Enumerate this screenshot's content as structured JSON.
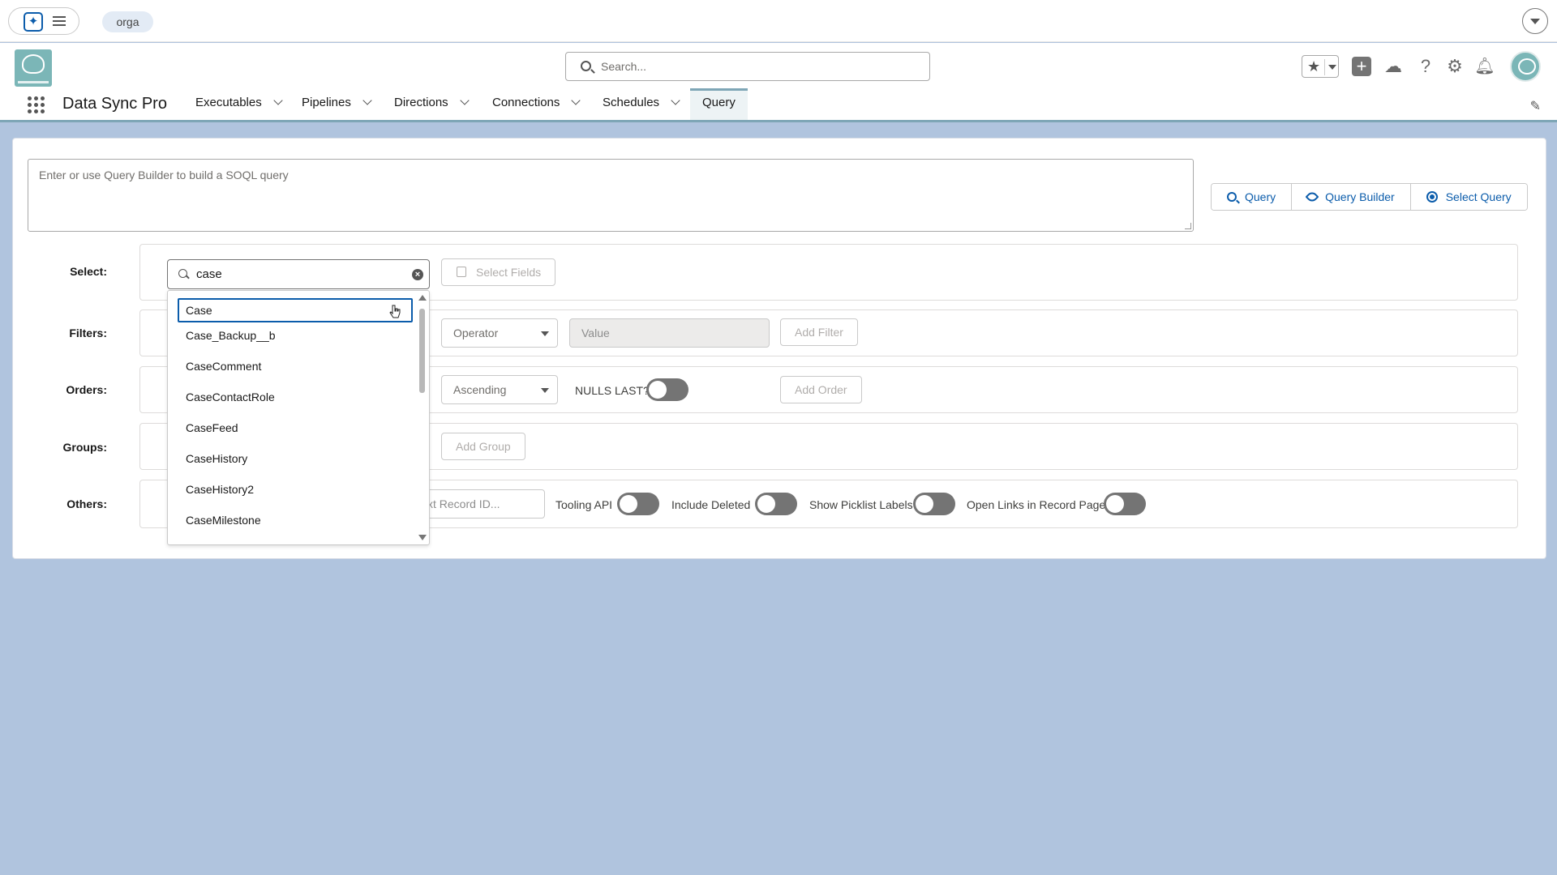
{
  "top_strip": {
    "org_chip": "orga"
  },
  "header": {
    "search_placeholder": "Search...",
    "icons": [
      "star-icon",
      "add-icon",
      "cloud-icon",
      "help-icon",
      "gear-icon",
      "bell-icon"
    ]
  },
  "nav": {
    "app_name": "Data Sync Pro",
    "items": [
      {
        "label": "Executables",
        "has_menu": true
      },
      {
        "label": "Pipelines",
        "has_menu": true
      },
      {
        "label": "Directions",
        "has_menu": true
      },
      {
        "label": "Connections",
        "has_menu": true
      },
      {
        "label": "Schedules",
        "has_menu": true
      },
      {
        "label": "Query",
        "has_menu": false,
        "active": true
      }
    ]
  },
  "query": {
    "soql_placeholder": "Enter or use Query Builder to build a SOQL query",
    "buttons": {
      "query": "Query",
      "query_builder": "Query Builder",
      "select_query": "Select Query"
    }
  },
  "builder": {
    "labels": {
      "select": "Select:",
      "filters": "Filters:",
      "orders": "Orders:",
      "groups": "Groups:",
      "others": "Others:"
    },
    "object_search_value": "case",
    "select_fields": "Select Fields",
    "operator_placeholder": "Operator",
    "value_placeholder": "Value",
    "add_filter": "Add Filter",
    "order_direction": "Ascending",
    "nulls_last": "NULLS LAST?",
    "add_order": "Add Order",
    "add_group": "Add Group",
    "record_id_placeholder": "xt Record ID...",
    "tooling_api": "Tooling API",
    "include_deleted": "Include Deleted",
    "show_picklist_labels": "Show Picklist Labels",
    "open_links": "Open Links in Record Page"
  },
  "dropdown": {
    "options": [
      "Case",
      "Case_Backup__b",
      "CaseComment",
      "CaseContactRole",
      "CaseFeed",
      "CaseHistory",
      "CaseHistory2",
      "CaseMilestone"
    ],
    "selected": "Case"
  },
  "colors": {
    "accent": "#0b5cab",
    "page_bg": "#b0c4de",
    "brand_teal": "#7bb6b7"
  }
}
